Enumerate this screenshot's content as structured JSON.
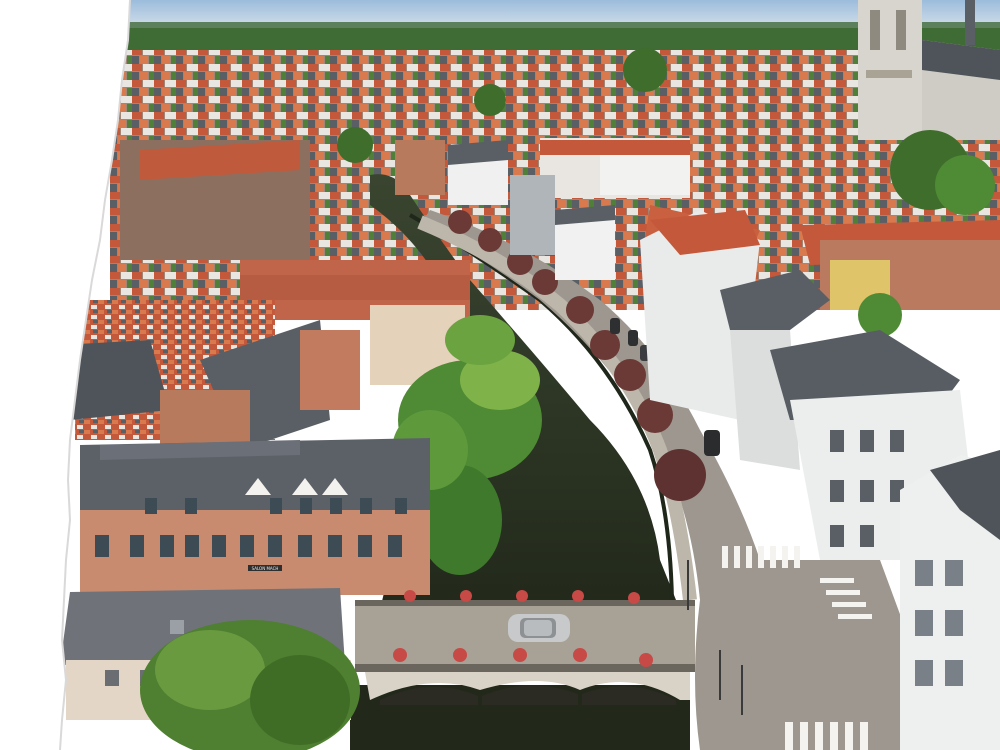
{
  "photo": {
    "subject": "aerial-townscape-with-canal",
    "palette": {
      "sky": "#a9c6e2",
      "horizon_haze": "#cfdbe6",
      "far_trees": "#3f6b35",
      "roof_red": "#c4583a",
      "roof_orange": "#d87a4e",
      "roof_slate": "#5a5f66",
      "wall_white": "#eef0ef",
      "wall_cream": "#e8dccb",
      "wall_brick": "#b77a5d",
      "canal_water": "#2c3522",
      "canal_edge": "#1f271a",
      "tree_green": "#4f8a34",
      "tree_light": "#7fb34a",
      "tree_purple": "#6b3a36",
      "street": "#9d978f",
      "sidewalk": "#bcb6ab",
      "bridge_stone": "#d9d2c6",
      "bridge_shadow": "#3b3832",
      "car_silver": "#c7c9cb",
      "cathedral": "#d8d5cf",
      "torn_edge": "#ffffff"
    },
    "elements": {
      "sign_text": "SALON MACH"
    }
  }
}
